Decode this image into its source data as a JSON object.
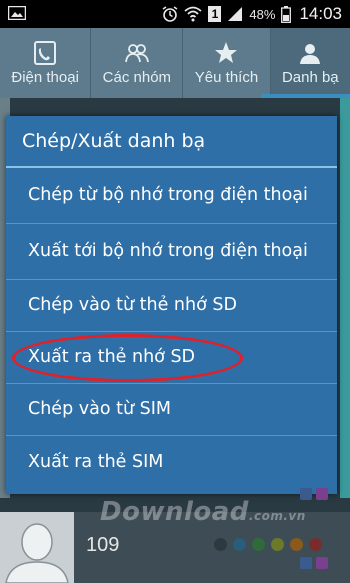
{
  "status_bar": {
    "battery": "48%",
    "sim_slot": "1",
    "time": "14:03",
    "icons": [
      "picture-icon",
      "alarm-icon",
      "wifi-icon",
      "signal-icon",
      "battery-icon"
    ]
  },
  "tabs": [
    {
      "label": "Điện thoại",
      "icon": "phone-icon"
    },
    {
      "label": "Các nhóm",
      "icon": "group-icon"
    },
    {
      "label": "Yêu thích",
      "icon": "star-icon"
    },
    {
      "label": "Danh bạ",
      "icon": "contact-icon"
    }
  ],
  "dialog": {
    "title": "Chép/Xuất danh bạ",
    "items": [
      {
        "label": "Chép từ bộ nhớ trong điện thoại"
      },
      {
        "label": "Xuất tới bộ nhớ trong điện thoại"
      },
      {
        "label": "Chép vào từ thẻ nhớ SD"
      },
      {
        "label": "Xuất ra thẻ nhớ SD",
        "highlighted": true
      },
      {
        "label": "Chép vào từ SIM"
      },
      {
        "label": "Xuất ra thẻ SIM"
      }
    ]
  },
  "contact": {
    "count": "109"
  },
  "watermark": {
    "text": "Download",
    "suffix": ".com.vn"
  },
  "colors": {
    "dialog_bg": "#2e6fa7",
    "highlight_ring": "#e0202a",
    "tab_bar": "#5d7b8c",
    "status_bar": "#000000"
  }
}
